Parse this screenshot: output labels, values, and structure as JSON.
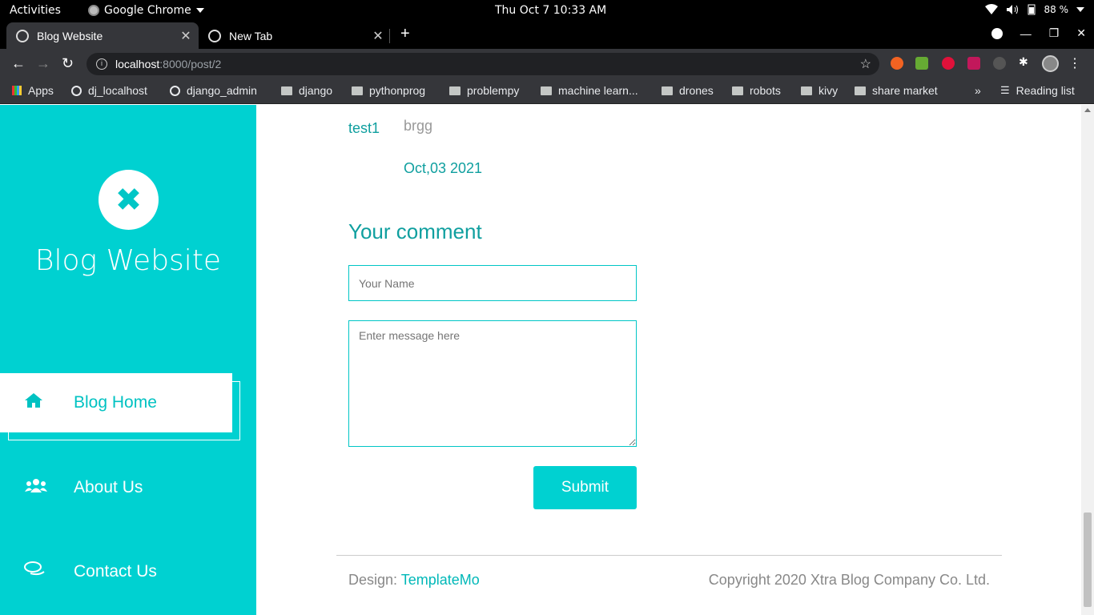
{
  "system_bar": {
    "activities": "Activities",
    "app_name": "Google Chrome",
    "clock": "Thu Oct 7  10:33 AM",
    "battery": "88 %"
  },
  "browser": {
    "tabs": [
      {
        "title": "Blog Website",
        "active": true
      },
      {
        "title": "New Tab",
        "active": false
      }
    ],
    "url_host": "localhost",
    "url_path": ":8000/post/2",
    "bookmarks": [
      "Apps",
      "dj_localhost",
      "django_admin",
      "django",
      "pythonprog",
      "problempy",
      "machine learn...",
      "drones",
      "robots",
      "kivy",
      "share market"
    ],
    "overflow": "»",
    "reading_list": "Reading list"
  },
  "sidebar": {
    "site_title": "Blog Website",
    "nav": [
      {
        "label": "Blog Home",
        "icon": "home-icon",
        "active": true
      },
      {
        "label": "About Us",
        "icon": "users-icon",
        "active": false
      },
      {
        "label": "Contact Us",
        "icon": "comments-icon",
        "active": false
      }
    ]
  },
  "comment": {
    "author": "test1",
    "text": "brgg",
    "date": "Oct,03 2021"
  },
  "form": {
    "heading": "Your comment",
    "name_placeholder": "Your Name",
    "message_placeholder": "Enter message here",
    "submit_label": "Submit"
  },
  "footer": {
    "design_prefix": "Design: ",
    "design_link": "TemplateMo",
    "copyright": "Copyright 2020 Xtra Blog Company Co. Ltd."
  },
  "colors": {
    "accent": "#00d1d1",
    "accent_text": "#0f9f9f"
  }
}
